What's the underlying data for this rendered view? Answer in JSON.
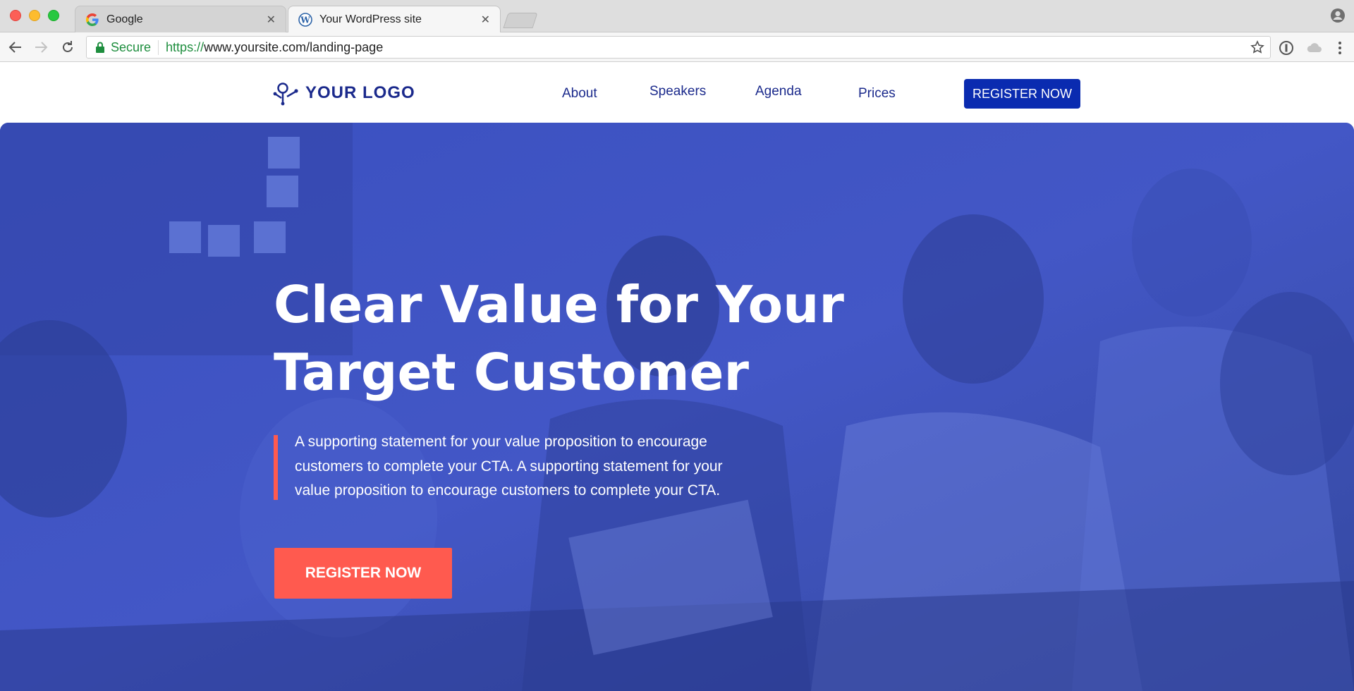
{
  "browser": {
    "tabs": [
      {
        "title": "Google",
        "icon": "google-icon",
        "active": false
      },
      {
        "title": "Your WordPress site",
        "icon": "wordpress-icon",
        "active": true
      }
    ],
    "address_bar": {
      "security_label": "Secure",
      "url_scheme": "https://",
      "url_rest": "www.yoursite.com/landing-page"
    }
  },
  "site": {
    "logo_text": "YOUR LOGO",
    "nav": [
      "About",
      "Speakers",
      "Agenda",
      "Prices"
    ],
    "header_cta": "REGISTER NOW"
  },
  "hero": {
    "title_line1": "Clear Value for Your",
    "title_line2": "Target Customer",
    "supporting_text": "A supporting statement for your value proposition to encourage customers to complete your CTA. A supporting statement for your value proposition to encourage customers to complete your CTA.",
    "cta_label": "REGISTER NOW"
  },
  "colors": {
    "brand_blue": "#0a2bb0",
    "hero_overlay": "#3f55c4",
    "accent_coral": "#ff5a4f",
    "secure_green": "#1e8e3e"
  }
}
